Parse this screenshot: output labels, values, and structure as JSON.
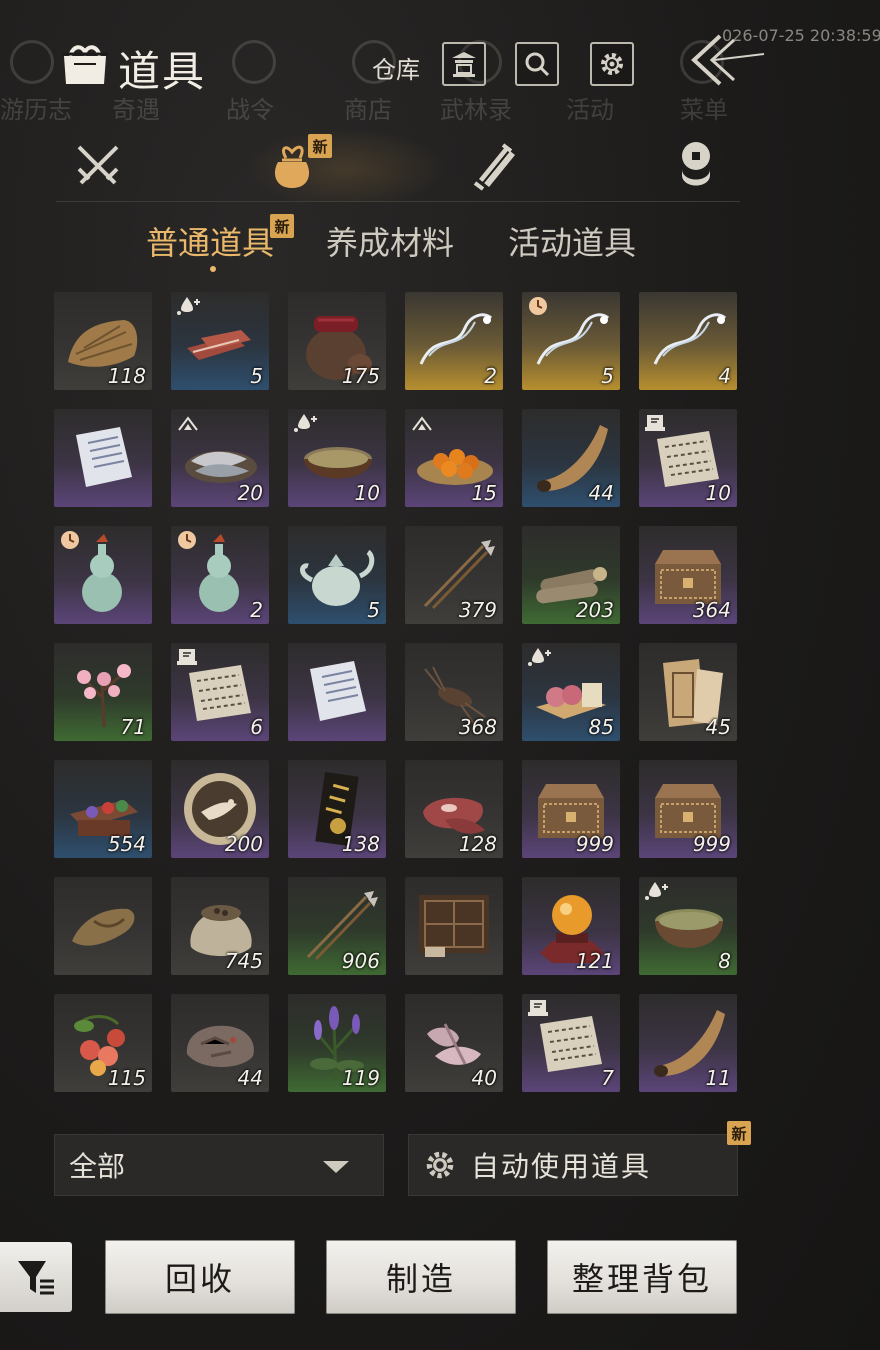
{
  "timestamp": "026-07-25 20:38:59",
  "background_nav": {
    "labels": [
      "游历志",
      "奇遇",
      "战令",
      "商店",
      "武林录",
      "活动",
      "菜单"
    ]
  },
  "header": {
    "title": "道具",
    "warehouse_label": "仓库",
    "icons": [
      "pavilion-icon",
      "search-icon",
      "gear-icon",
      "back-arrow-icon"
    ]
  },
  "categories": {
    "tabs": [
      {
        "icon": "crossed-swords-icon",
        "active": false
      },
      {
        "icon": "pouch-icon",
        "active": true,
        "badge": "新"
      },
      {
        "icon": "scroll-icon",
        "active": false
      },
      {
        "icon": "coin-stack-icon",
        "active": false
      }
    ]
  },
  "subtabs": [
    {
      "label": "普通道具",
      "active": true,
      "badge": "新"
    },
    {
      "label": "养成材料",
      "active": false
    },
    {
      "label": "活动道具",
      "active": false
    }
  ],
  "colors": {
    "active_gold": "#e9b86b",
    "badge": "#d9a452",
    "rarity_gray": "#3f3e3b",
    "rarity_blue": "#2e4f6e",
    "rarity_purple": "#5b4578",
    "rarity_green": "#3f6a33",
    "rarity_gold": "#b78f2f"
  },
  "items": [
    {
      "name": "straw-bundle-item",
      "icon": "straw-icon",
      "rarity": "gray",
      "qty": "118"
    },
    {
      "name": "dried-meat-item",
      "icon": "meat-strips-icon",
      "rarity": "blue",
      "qty": "5",
      "tag": "droplet"
    },
    {
      "name": "wine-jar-item",
      "icon": "jar-icon",
      "rarity": "gray",
      "qty": "175"
    },
    {
      "name": "silver-dragon-item",
      "icon": "dragon-swirl-icon",
      "rarity": "gold",
      "qty": "2"
    },
    {
      "name": "blue-dragon-item",
      "icon": "dragon-swirl-icon",
      "rarity": "gold",
      "qty": "5",
      "tag": "clock"
    },
    {
      "name": "white-dragon-item",
      "icon": "dragon-swirl-icon",
      "rarity": "gold",
      "qty": "4"
    },
    {
      "name": "letter-item",
      "icon": "paper-icon",
      "rarity": "purple",
      "qty": ""
    },
    {
      "name": "fish-platter-item",
      "icon": "fish-icon",
      "rarity": "purple",
      "qty": "20",
      "tag": "arrow"
    },
    {
      "name": "soup-bowl-item",
      "icon": "bowl-icon",
      "rarity": "purple",
      "qty": "10",
      "tag": "droplet"
    },
    {
      "name": "orange-plate-item",
      "icon": "fruit-plate-icon",
      "rarity": "purple",
      "qty": "15",
      "tag": "arrow"
    },
    {
      "name": "bronze-horn-item",
      "icon": "horn-icon",
      "rarity": "blue",
      "qty": "44"
    },
    {
      "name": "manuscript-item",
      "icon": "manuscript-icon",
      "rarity": "purple",
      "qty": "10",
      "tag": "book"
    },
    {
      "name": "gourd-vase-a-item",
      "icon": "gourd-icon",
      "rarity": "purple",
      "qty": "",
      "tag": "clock"
    },
    {
      "name": "gourd-vase-b-item",
      "icon": "gourd-icon",
      "rarity": "purple",
      "qty": "2",
      "tag": "clock"
    },
    {
      "name": "teapot-item",
      "icon": "teapot-icon",
      "rarity": "blue",
      "qty": "5"
    },
    {
      "name": "arrows-item",
      "icon": "arrows-icon",
      "rarity": "gray",
      "qty": "379"
    },
    {
      "name": "firewood-item",
      "icon": "logs-icon",
      "rarity": "green",
      "qty": "203"
    },
    {
      "name": "carved-chest-a-item",
      "icon": "chest-icon",
      "rarity": "purple",
      "qty": "364"
    },
    {
      "name": "peach-blossom-item",
      "icon": "blossom-icon",
      "rarity": "green",
      "qty": "71"
    },
    {
      "name": "script-pages-item",
      "icon": "manuscript-icon",
      "rarity": "purple",
      "qty": "6",
      "tag": "book"
    },
    {
      "name": "notice-paper-item",
      "icon": "paper-icon",
      "rarity": "purple",
      "qty": ""
    },
    {
      "name": "cricket-item",
      "icon": "cricket-icon",
      "rarity": "gray",
      "qty": "368"
    },
    {
      "name": "peach-buns-item",
      "icon": "buns-icon",
      "rarity": "blue",
      "qty": "85",
      "tag": "droplet"
    },
    {
      "name": "bamboo-slip-item",
      "icon": "slip-icon",
      "rarity": "gray",
      "qty": "45"
    },
    {
      "name": "pigment-box-item",
      "icon": "pigment-box-icon",
      "rarity": "blue",
      "qty": "554"
    },
    {
      "name": "crane-token-item",
      "icon": "crane-coin-icon",
      "rarity": "purple",
      "qty": "200"
    },
    {
      "name": "gold-plaque-item",
      "icon": "plaque-icon",
      "rarity": "purple",
      "qty": "138"
    },
    {
      "name": "raw-meat-item",
      "icon": "meat-icon",
      "rarity": "gray",
      "qty": "128"
    },
    {
      "name": "carved-chest-b-item",
      "icon": "chest-icon",
      "rarity": "purple",
      "qty": "999"
    },
    {
      "name": "carved-chest-c-item",
      "icon": "chest-icon",
      "rarity": "purple",
      "qty": "999"
    },
    {
      "name": "straw-sandal-item",
      "icon": "sandal-icon",
      "rarity": "gray",
      "qty": ""
    },
    {
      "name": "seed-sack-item",
      "icon": "sack-icon",
      "rarity": "gray",
      "qty": "745"
    },
    {
      "name": "fire-arrows-item",
      "icon": "arrows-icon",
      "rarity": "green",
      "qty": "906"
    },
    {
      "name": "cabinet-item",
      "icon": "cabinet-icon",
      "rarity": "gray",
      "qty": ""
    },
    {
      "name": "golden-orb-item",
      "icon": "orb-icon",
      "rarity": "purple",
      "qty": "121"
    },
    {
      "name": "stew-pot-item",
      "icon": "pot-icon",
      "rarity": "green",
      "qty": "8",
      "tag": "droplet"
    },
    {
      "name": "wild-fruit-item",
      "icon": "berries-icon",
      "rarity": "gray",
      "qty": "115"
    },
    {
      "name": "ore-rock-item",
      "icon": "rock-icon",
      "rarity": "gray",
      "qty": "44"
    },
    {
      "name": "lavender-item",
      "icon": "herb-icon",
      "rarity": "green",
      "qty": "119"
    },
    {
      "name": "raw-cuts-item",
      "icon": "cuts-icon",
      "rarity": "gray",
      "qty": "40"
    },
    {
      "name": "letters-stack-item",
      "icon": "manuscript-icon",
      "rarity": "purple",
      "qty": "7",
      "tag": "book"
    },
    {
      "name": "purple-horn-item",
      "icon": "horn-icon",
      "rarity": "purple",
      "qty": "11"
    }
  ],
  "filter": {
    "selected": "全部"
  },
  "auto_use": {
    "label": "自动使用道具",
    "badge": "新"
  },
  "actions": {
    "recycle": "回收",
    "craft": "制造",
    "organize": "整理背包"
  }
}
